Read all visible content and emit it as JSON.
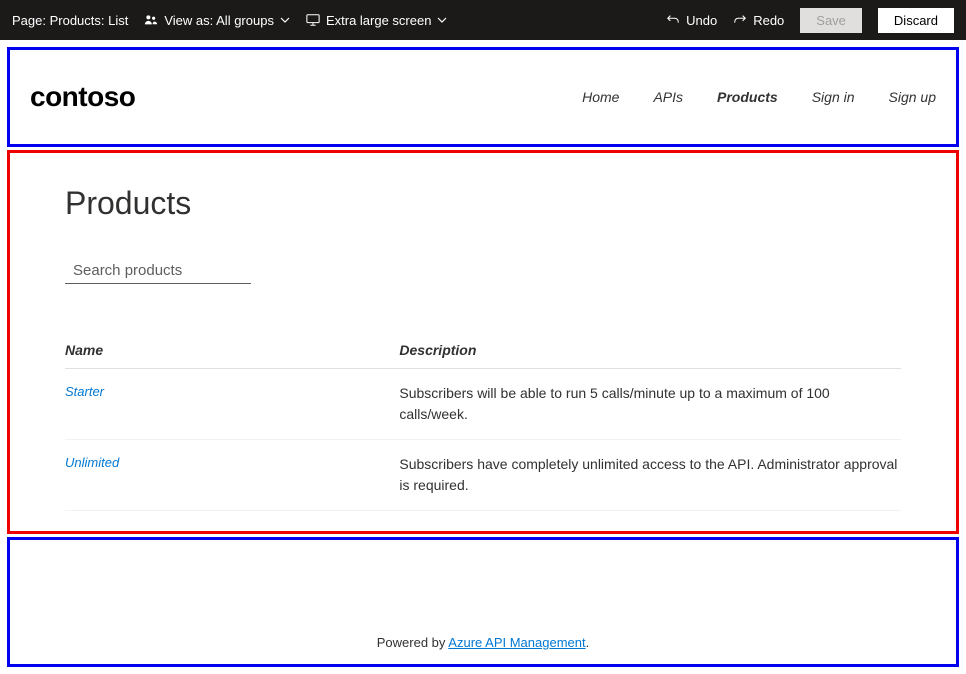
{
  "topbar": {
    "page_label": "Page: Products: List",
    "view_as_label": "View as: All groups",
    "screen_label": "Extra large screen",
    "undo": "Undo",
    "redo": "Redo",
    "save": "Save",
    "discard": "Discard"
  },
  "header": {
    "brand": "contoso",
    "nav": {
      "home": "Home",
      "apis": "APIs",
      "products": "Products",
      "signin": "Sign in",
      "signup": "Sign up"
    }
  },
  "main": {
    "title": "Products",
    "search_placeholder": "Search products",
    "columns": {
      "name": "Name",
      "description": "Description"
    },
    "rows": [
      {
        "name": "Starter",
        "description": "Subscribers will be able to run 5 calls/minute up to a maximum of 100 calls/week."
      },
      {
        "name": "Unlimited",
        "description": "Subscribers have completely unlimited access to the API. Administrator approval is required."
      }
    ]
  },
  "footer": {
    "prefix": "Powered by ",
    "link": "Azure API Management",
    "suffix": "."
  }
}
